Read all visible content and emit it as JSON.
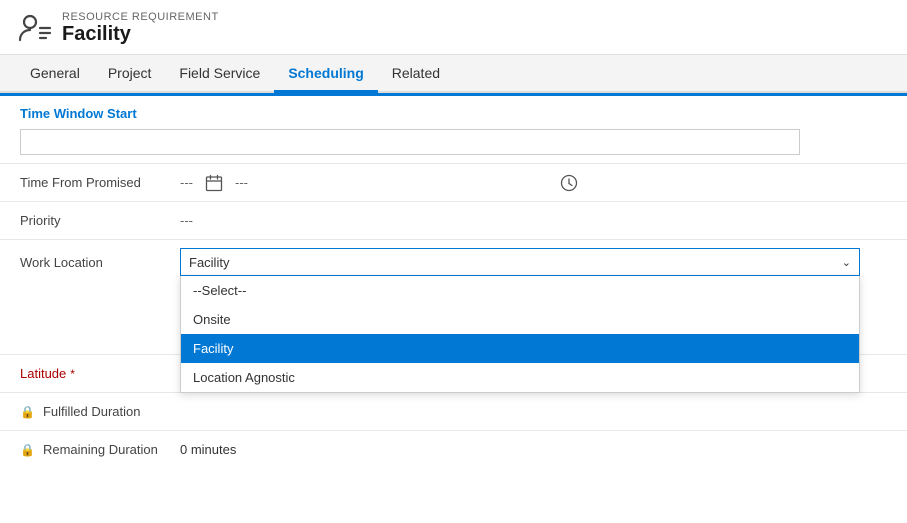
{
  "header": {
    "subtitle": "RESOURCE REQUIREMENT",
    "title": "Facility"
  },
  "nav": {
    "tabs": [
      {
        "label": "General",
        "active": false
      },
      {
        "label": "Project",
        "active": false
      },
      {
        "label": "Field Service",
        "active": false
      },
      {
        "label": "Scheduling",
        "active": true
      },
      {
        "label": "Related",
        "active": false
      }
    ]
  },
  "form": {
    "section_title": "Time Window Start",
    "time_input_placeholder": "",
    "time_from_promised_label": "Time From Promised",
    "time_from_promised_value1": "---",
    "time_from_promised_value2": "---",
    "priority_label": "Priority",
    "priority_value": "---",
    "work_location_label": "Work Location",
    "work_location_selected": "Facility",
    "latitude_label": "Latitude",
    "latitude_required": true,
    "fulfilled_duration_label": "Fulfilled Duration",
    "remaining_duration_label": "Remaining Duration",
    "remaining_duration_value": "0 minutes",
    "dropdown_options": [
      {
        "label": "--Select--",
        "value": "select",
        "selected": false
      },
      {
        "label": "Onsite",
        "value": "onsite",
        "selected": false
      },
      {
        "label": "Facility",
        "value": "facility",
        "selected": true
      },
      {
        "label": "Location Agnostic",
        "value": "location_agnostic",
        "selected": false
      }
    ]
  },
  "icons": {
    "person_list": "👤≡",
    "lock": "🔒",
    "calendar": "📅",
    "clock": "🕐",
    "chevron_down": "∨"
  }
}
